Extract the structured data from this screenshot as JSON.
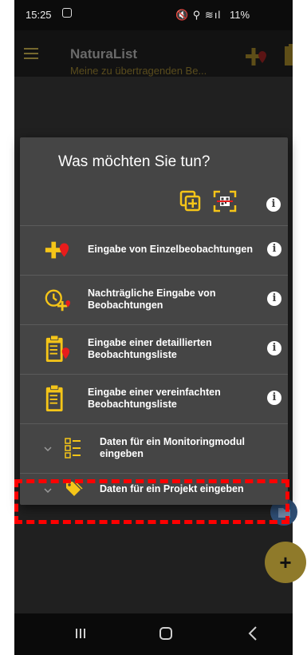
{
  "status_bar": {
    "time": "15:25",
    "right_icons": "🔇 ⚲ ≋ıl",
    "battery": "11%"
  },
  "app_bar": {
    "title": "NaturaList",
    "subtitle": "Meine zu übertragenden Be..."
  },
  "dialog": {
    "title": "Was möchten Sie tun?",
    "items": [
      {
        "label": "Eingabe von Einzelbeobachtungen",
        "icon": "add-observation-icon",
        "info": true
      },
      {
        "label": "Nachträgliche Eingabe von Beobachtungen",
        "icon": "clock-add-icon",
        "info": true
      },
      {
        "label": "Eingabe einer detaillierten Beobachtungsliste",
        "icon": "detailed-list-icon",
        "info": true
      },
      {
        "label": "Eingabe einer vereinfachten Beobachtungsliste",
        "icon": "simple-list-icon",
        "info": true
      },
      {
        "label": "Daten für ein Monitoringmodul eingeben",
        "icon": "monitoring-module-icon",
        "info": false
      },
      {
        "label": "Daten für ein Projekt eingeben",
        "icon": "tag-icon",
        "info": false
      }
    ]
  },
  "fab": {
    "add_label": "+"
  },
  "colors": {
    "accent": "#f5c518",
    "marker_red": "#e81c1c",
    "dialog_bg": "#454545",
    "highlight": "#ff0000"
  }
}
